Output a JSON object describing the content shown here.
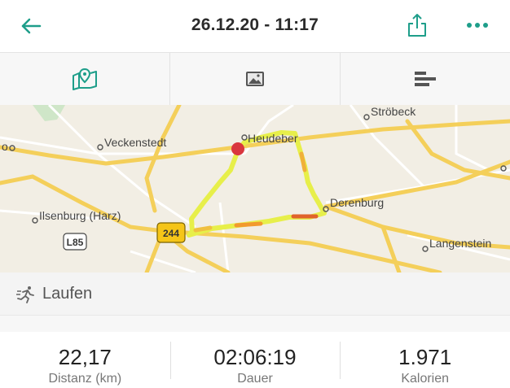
{
  "header": {
    "title": "26.12.20 - 11:17",
    "back_icon": "arrow-left-icon",
    "share_icon": "share-icon",
    "more_icon": "more-horizontal-icon",
    "accent_color": "#1e9e8a"
  },
  "tabs": [
    {
      "icon": "map-pin-icon",
      "active": true
    },
    {
      "icon": "image-icon",
      "active": false
    },
    {
      "icon": "stats-bars-icon",
      "active": false
    }
  ],
  "map": {
    "places": [
      "Veckenstedt",
      "Heudeber",
      "Ströbeck",
      "Derenburg",
      "Ilsenburg (Harz)",
      "Langenstein"
    ],
    "road_badges": [
      "L85",
      "244"
    ],
    "edge_label_o": "o"
  },
  "activity": {
    "icon": "running-icon",
    "label": "Laufen"
  },
  "stats": [
    {
      "value": "22,17",
      "unit": "Distanz (km)"
    },
    {
      "value": "02:06:19",
      "unit": "Dauer"
    },
    {
      "value": "1.971",
      "unit": "Kalorien"
    }
  ]
}
